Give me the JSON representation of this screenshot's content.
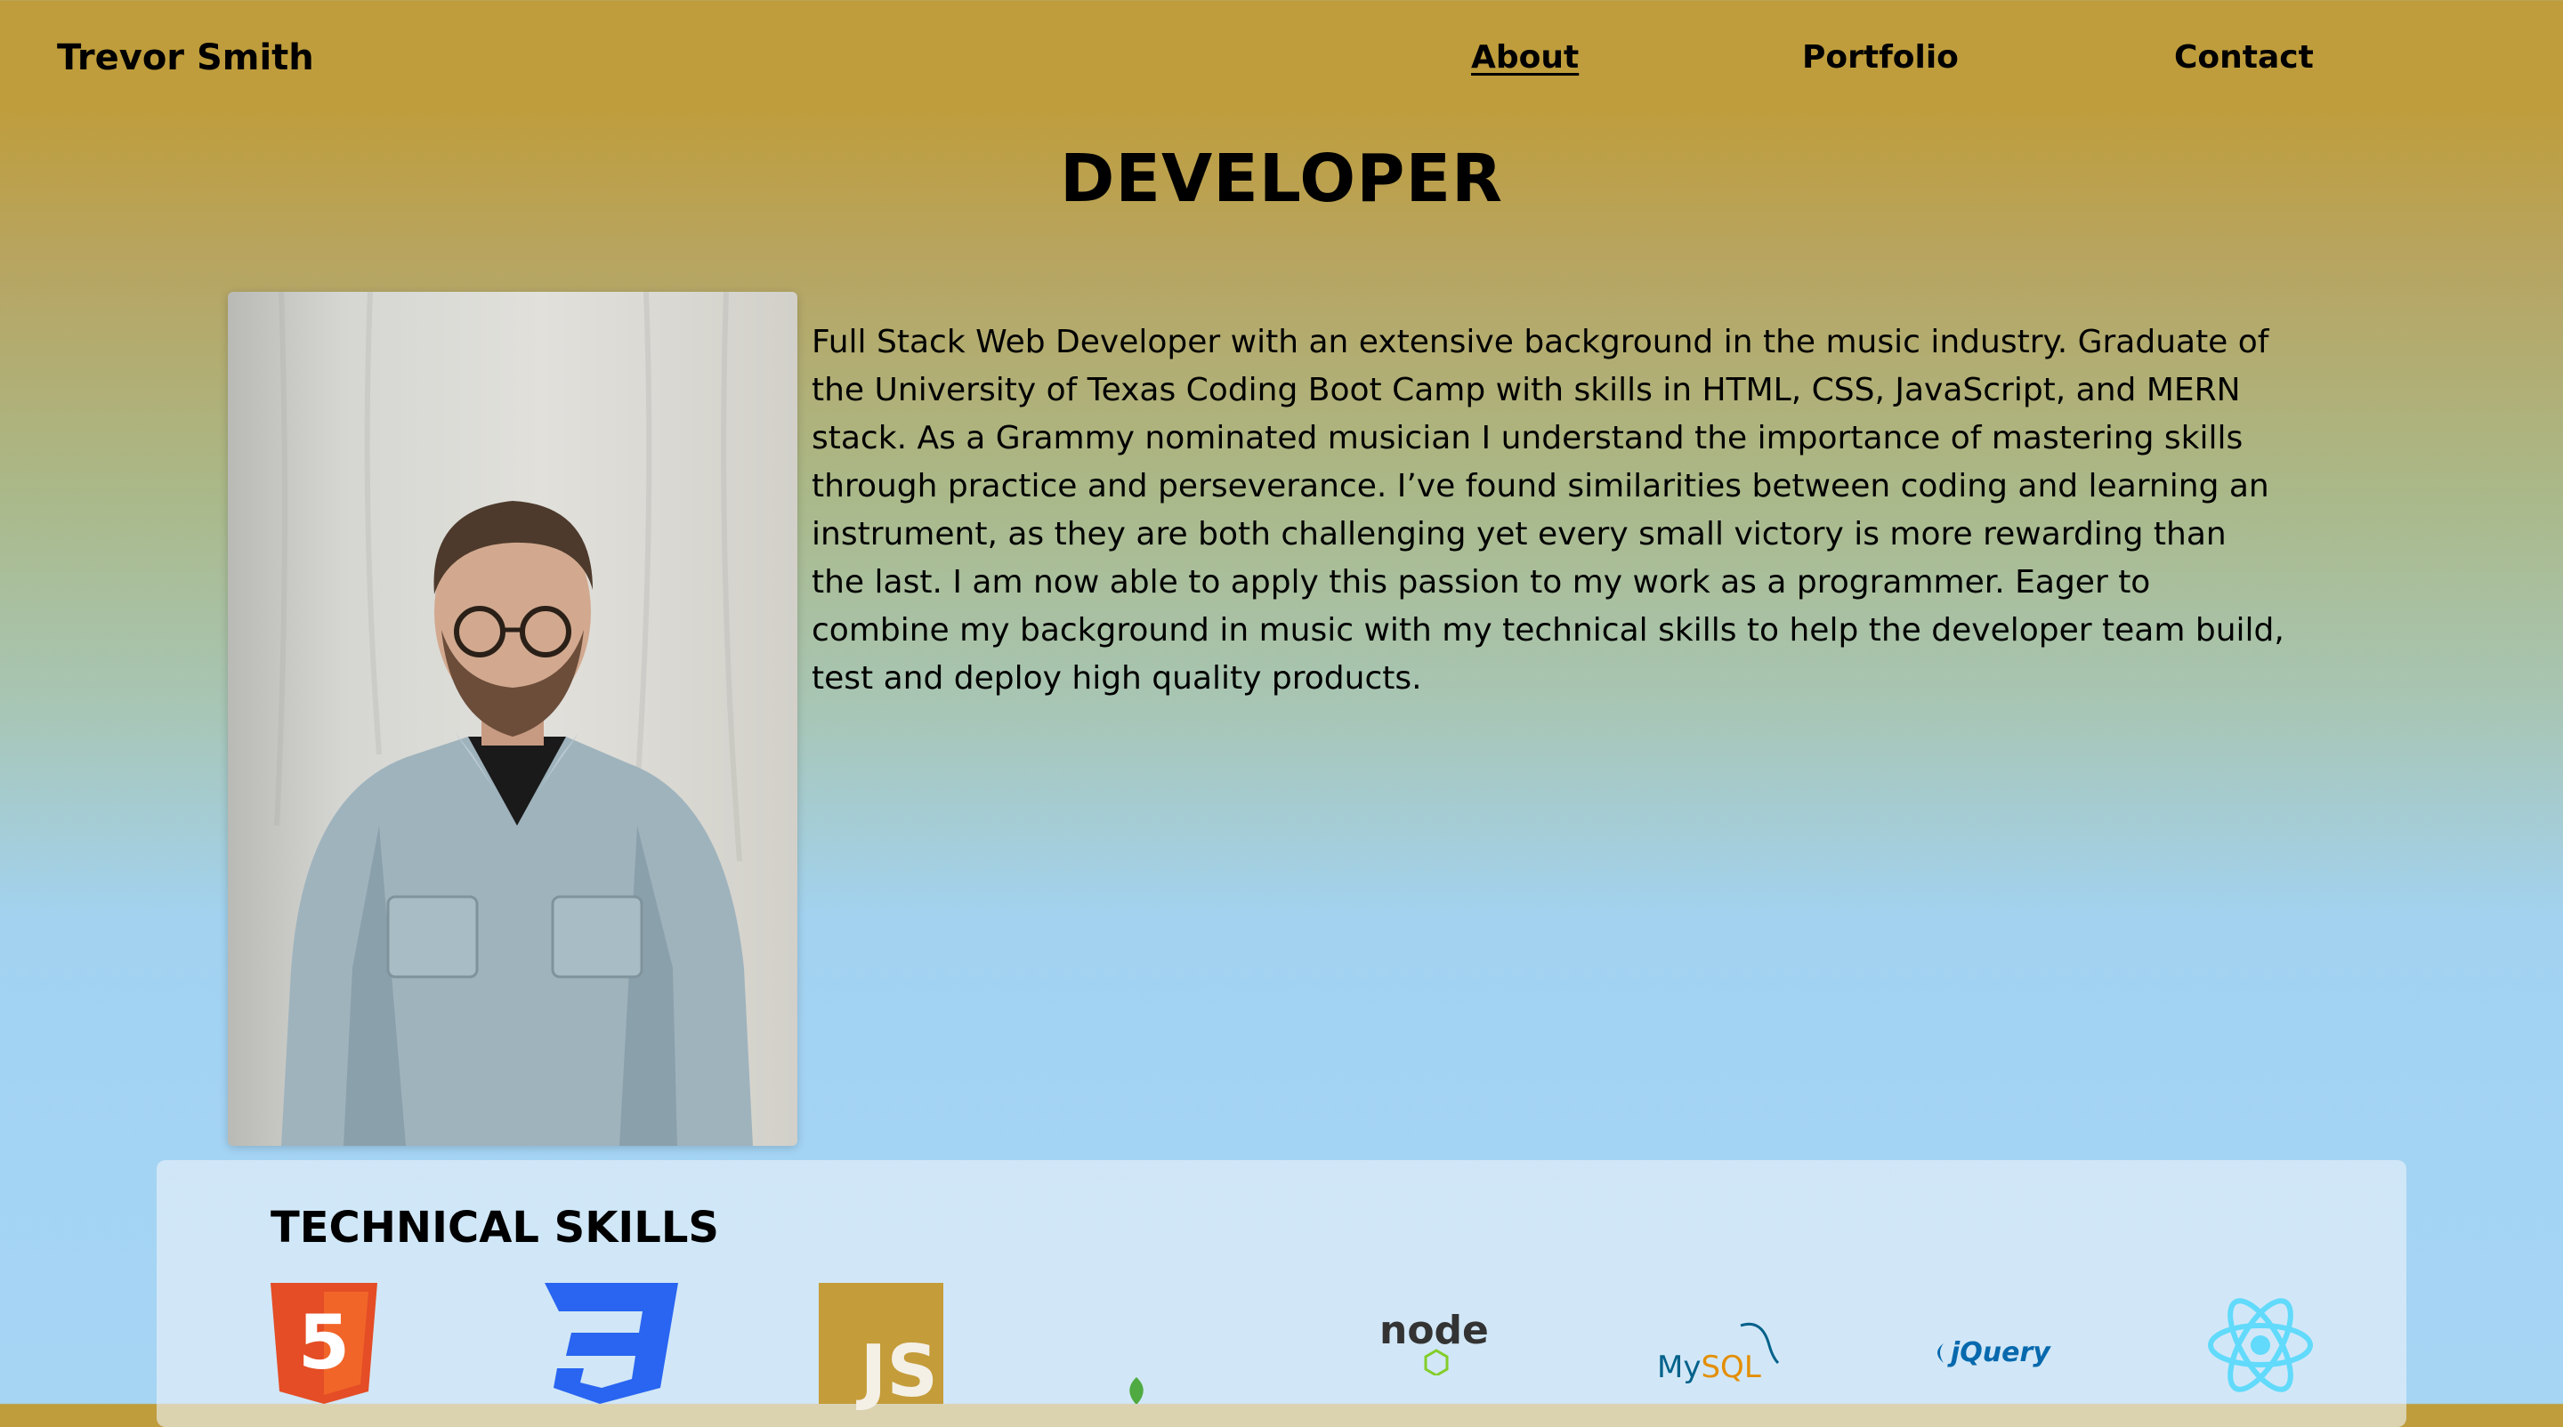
{
  "header": {
    "brand": "Trevor Smith",
    "nav": [
      {
        "label": "About",
        "active": true
      },
      {
        "label": "Portfolio",
        "active": false
      },
      {
        "label": "Contact",
        "active": false
      }
    ]
  },
  "hero": {
    "title": "DEVELOPER",
    "bio": "Full Stack Web Developer with an extensive background in the music industry. Graduate of the University of Texas Coding Boot Camp with skills in HTML, CSS, JavaScript, and MERN stack. As a Grammy nominated musician I understand the importance of mastering skills through practice and perseverance. I’ve found similarities between coding and learning an instrument, as they are both challenging yet every small victory is more rewarding than the last. I am now able to apply this passion to my work as a programmer. Eager to combine my background in music with my technical skills to help the developer team build, test and deploy high quality products."
  },
  "skills": {
    "title": "TECHNICAL SKILLS",
    "items": [
      {
        "icon": "html5-icon",
        "text": "5",
        "color": "#e44d26"
      },
      {
        "icon": "css3-icon",
        "text": "",
        "color": "#2965f1"
      },
      {
        "icon": "javascript-icon",
        "text": "JS",
        "color": "#c49c3a"
      },
      {
        "icon": "mongodb-icon",
        "text": "",
        "color": "#4faa41"
      },
      {
        "icon": "nodejs-icon",
        "text": "node",
        "color": "#333333"
      },
      {
        "icon": "mysql-icon",
        "text_my": "My",
        "text_sql": "SQL",
        "color_my": "#00618a",
        "color_sql": "#e48e00"
      },
      {
        "icon": "jquery-icon",
        "text": "jQuery",
        "color": "#0769ad"
      },
      {
        "icon": "react-icon",
        "text": "",
        "color": "#61dafb"
      }
    ]
  },
  "colors": {
    "header_gold": "#bf9d3c",
    "background_blue": "#a3d3f3"
  }
}
